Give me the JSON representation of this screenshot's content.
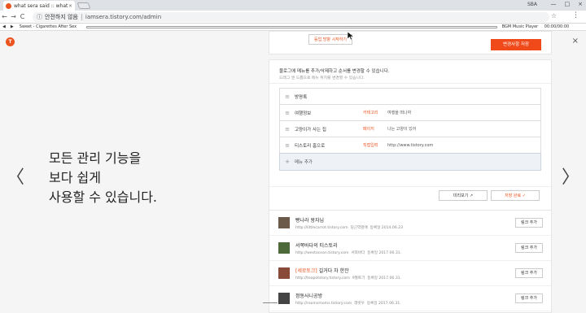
{
  "browser": {
    "tab_title": "what sera said :: what s",
    "tab_close": "×",
    "profile": "SBA",
    "win_min": "—",
    "win_max": "□",
    "win_close": "×",
    "back": "←",
    "forward": "→",
    "reload": "C",
    "security_icon": "ⓘ",
    "security_label": "안전하지 않음",
    "url": "iamsera.tistory.com/admin",
    "star": "☆",
    "menu": "⋮"
  },
  "music": {
    "prev": "◀",
    "next": "▶",
    "song": "Sweet - Cigarettes After Sex",
    "player": "BGM Music Player",
    "time": "00:00/00:00"
  },
  "page": {
    "logo": "T",
    "close": "×",
    "arrow_left": "〈",
    "arrow_right": "〉",
    "headline": [
      "모든 관리 기능을",
      "보다 쉽게",
      "사용할 수 있습니다."
    ]
  },
  "settings_card": {
    "tooltip": "등업 방향 시작하기",
    "save_label": "변경사항 저장"
  },
  "menu_card": {
    "desc": "블로그에 메뉴를 추가/삭제하고 순서를 변경할 수 있습니다.",
    "subdesc": "드래그 앤 드롭으로 메뉴 위치를 변경할 수 있습니다.",
    "items": [
      {
        "name": "방명록",
        "type": "",
        "value": ""
      },
      {
        "name": "여행정보",
        "type": "카테고리",
        "value": "여행을 떠나자"
      },
      {
        "name": "고양이가 사는 집",
        "type": "페이지",
        "value": "나는 고양이 있어"
      },
      {
        "name": "티스토리 홈으로",
        "type": "직접입력",
        "value": "http://www.tistory.com"
      }
    ],
    "add_label": "메뉴 추가",
    "preview_label": "미리보기 ↗",
    "apply_label": "저장 완료 ✓"
  },
  "links": [
    {
      "tag": "",
      "name": "빵나라 왕자님",
      "url": "http://littlecarrot.tistory.com",
      "owner": "당근역할애",
      "date": "등록일 2014.06.23",
      "add": "링크 추가",
      "thumb_color": "#6b5a4a"
    },
    {
      "tag": "",
      "name": "서쪽바다의 티스토리",
      "url": "http://westocean.tistory.com",
      "owner": "서쪽바다",
      "date": "등록일 2017.06.31.",
      "add": "링크 추가",
      "thumb_color": "#4f6a3a"
    },
    {
      "tag": "[세로토크]",
      "name": "길거다 차 한잔",
      "url": "http://teapotstory.tistory.com",
      "owner": "9월토기",
      "date": "등록일 2017.06.31.",
      "add": "링크 추가",
      "thumb_color": "#8a4a3a"
    },
    {
      "tag": "",
      "name": "정동사니공방",
      "url": "http://roomsmoms.tistory.com",
      "owner": "래빗우",
      "date": "등록일 2017.06.31.",
      "add": "링크 추가",
      "thumb_color": "#444444"
    }
  ]
}
